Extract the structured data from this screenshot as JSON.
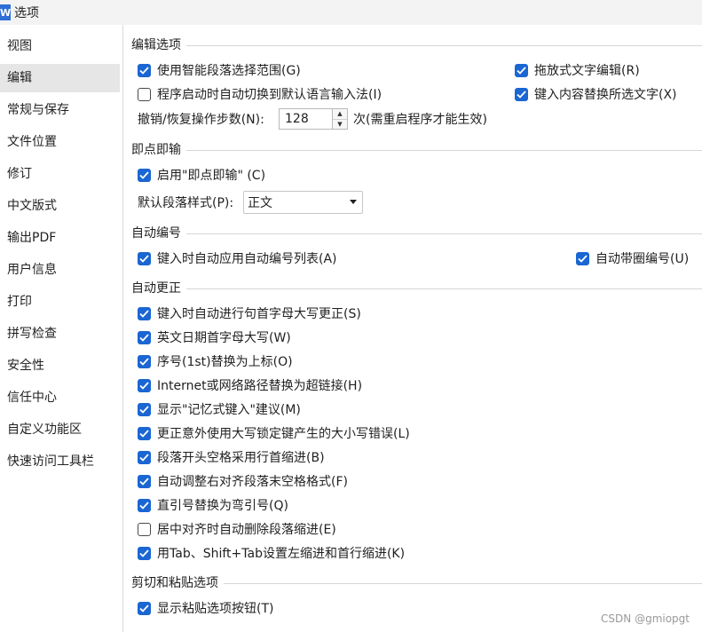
{
  "window": {
    "title": "选项",
    "app_icon_letter": "W"
  },
  "sidebar": {
    "items": [
      {
        "label": "视图",
        "active": false
      },
      {
        "label": "编辑",
        "active": true
      },
      {
        "label": "常规与保存",
        "active": false
      },
      {
        "label": "文件位置",
        "active": false
      },
      {
        "label": "修订",
        "active": false
      },
      {
        "label": "中文版式",
        "active": false
      },
      {
        "label": "输出PDF",
        "active": false
      },
      {
        "label": "用户信息",
        "active": false
      },
      {
        "label": "打印",
        "active": false
      },
      {
        "label": "拼写检查",
        "active": false
      },
      {
        "label": "安全性",
        "active": false
      },
      {
        "label": "信任中心",
        "active": false
      },
      {
        "label": "自定义功能区",
        "active": false
      },
      {
        "label": "快速访问工具栏",
        "active": false
      }
    ]
  },
  "edit_options": {
    "title": "编辑选项",
    "smart_paragraph": {
      "label": "使用智能段落选择范围(G)",
      "checked": true
    },
    "drag_edit": {
      "label": "拖放式文字编辑(R)",
      "checked": true
    },
    "auto_switch_lang": {
      "label": "程序启动时自动切换到默认语言输入法(I)",
      "checked": false
    },
    "replace_selected": {
      "label": "键入内容替换所选文字(X)",
      "checked": true
    },
    "undo_steps_label": "撤销/恢复操作步数(N):",
    "undo_steps_value": "128",
    "undo_steps_note": "次(需重启程序才能生效)"
  },
  "instant_input": {
    "title": "即点即输",
    "enable": {
      "label": "启用\"即点即输\" (C)",
      "checked": true
    },
    "default_style_label": "默认段落样式(P):",
    "default_style_value": "正文"
  },
  "auto_numbering": {
    "title": "自动编号",
    "auto_list": {
      "label": "键入时自动应用自动编号列表(A)",
      "checked": true
    },
    "circled_number": {
      "label": "自动带圈编号(U)",
      "checked": true
    }
  },
  "auto_correct": {
    "title": "自动更正",
    "items": [
      {
        "label": "键入时自动进行句首字母大写更正(S)",
        "checked": true
      },
      {
        "label": "英文日期首字母大写(W)",
        "checked": true
      },
      {
        "label": "序号(1st)替换为上标(O)",
        "checked": true
      },
      {
        "label": "Internet或网络路径替换为超链接(H)",
        "checked": true
      },
      {
        "label": "显示\"记忆式键入\"建议(M)",
        "checked": true
      },
      {
        "label": "更正意外使用大写锁定键产生的大小写错误(L)",
        "checked": true
      },
      {
        "label": "段落开头空格采用行首缩进(B)",
        "checked": true
      },
      {
        "label": "自动调整右对齐段落末空格格式(F)",
        "checked": true
      },
      {
        "label": "直引号替换为弯引号(Q)",
        "checked": true
      },
      {
        "label": "居中对齐时自动删除段落缩进(E)",
        "checked": false
      },
      {
        "label": "用Tab、Shift+Tab设置左缩进和首行缩进(K)",
        "checked": true
      }
    ]
  },
  "cut_paste": {
    "title": "剪切和粘贴选项",
    "show_paste_button": {
      "label": "显示粘贴选项按钮(T)",
      "checked": true
    }
  },
  "watermark": "CSDN @gmiopgt",
  "colors": {
    "checkbox_checked": "#1a66d2",
    "active_nav": "#e6e6e6"
  }
}
